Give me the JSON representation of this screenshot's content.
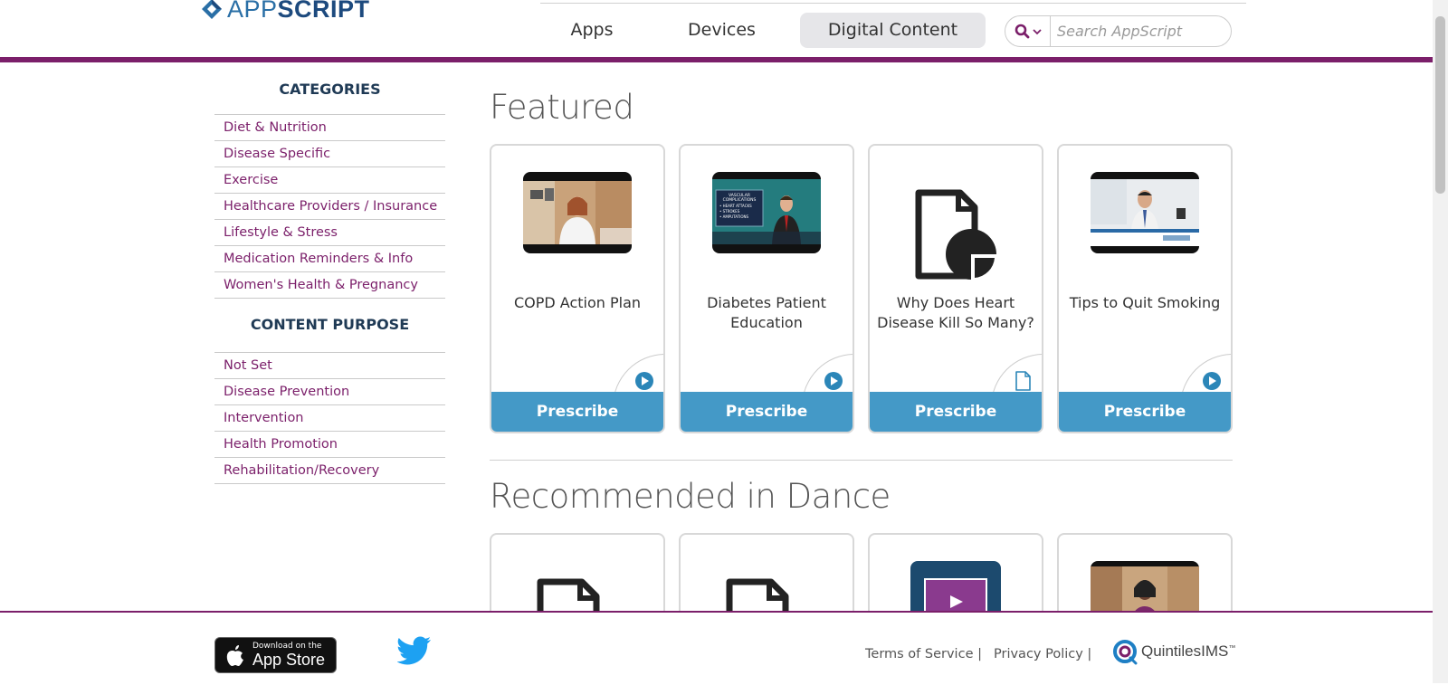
{
  "header": {
    "logo_text_light": "APP",
    "logo_text_bold": "SCRIPT",
    "nav": [
      {
        "label": "Apps"
      },
      {
        "label": "Devices"
      },
      {
        "label": "Digital Content",
        "active": true
      }
    ],
    "search": {
      "placeholder": "Search AppScript"
    }
  },
  "sidebar": {
    "categories_heading": "CATEGORIES",
    "categories": [
      "Diet & Nutrition",
      "Disease Specific",
      "Exercise",
      "Healthcare Providers / Insurance",
      "Lifestyle & Stress",
      "Medication Reminders & Info",
      "Women's Health & Pregnancy"
    ],
    "purpose_heading": "CONTENT PURPOSE",
    "purposes": [
      "Not Set",
      "Disease Prevention",
      "Intervention",
      "Health Promotion",
      "Rehabilitation/Recovery"
    ]
  },
  "main": {
    "featured_title": "Featured",
    "featured": [
      {
        "title": "COPD Action Plan",
        "type": "video-icon",
        "cta": "Prescribe"
      },
      {
        "title": "Diabetes Patient Education",
        "type": "video-icon",
        "cta": "Prescribe",
        "thumb_text": [
          "VASCULAR",
          "COMPLICATIONS",
          "• HEART ATTACKS",
          "• STROKES",
          "• AMPUTATIONS"
        ]
      },
      {
        "title": "Why Does Heart Disease Kill So Many?",
        "type": "document-icon",
        "cta": "Prescribe"
      },
      {
        "title": "Tips to Quit Smoking",
        "type": "video-icon",
        "cta": "Prescribe"
      }
    ],
    "recommended_title": "Recommended in Dance",
    "recommended": [
      {
        "type": "document-icon"
      },
      {
        "type": "document-icon"
      },
      {
        "type": "video-icon"
      },
      {
        "type": "video-icon"
      }
    ]
  },
  "footer": {
    "appstore_small": "Download on the",
    "appstore_big": "App Store",
    "terms": "Terms of Service |",
    "privacy": "Privacy Policy |",
    "company": "QuintilesIMS",
    "company_tm": "™"
  },
  "colors": {
    "brand_purple": "#7b1f6a",
    "prescribe_blue": "#4499c7",
    "logo_blue": "#2a6fa6"
  }
}
